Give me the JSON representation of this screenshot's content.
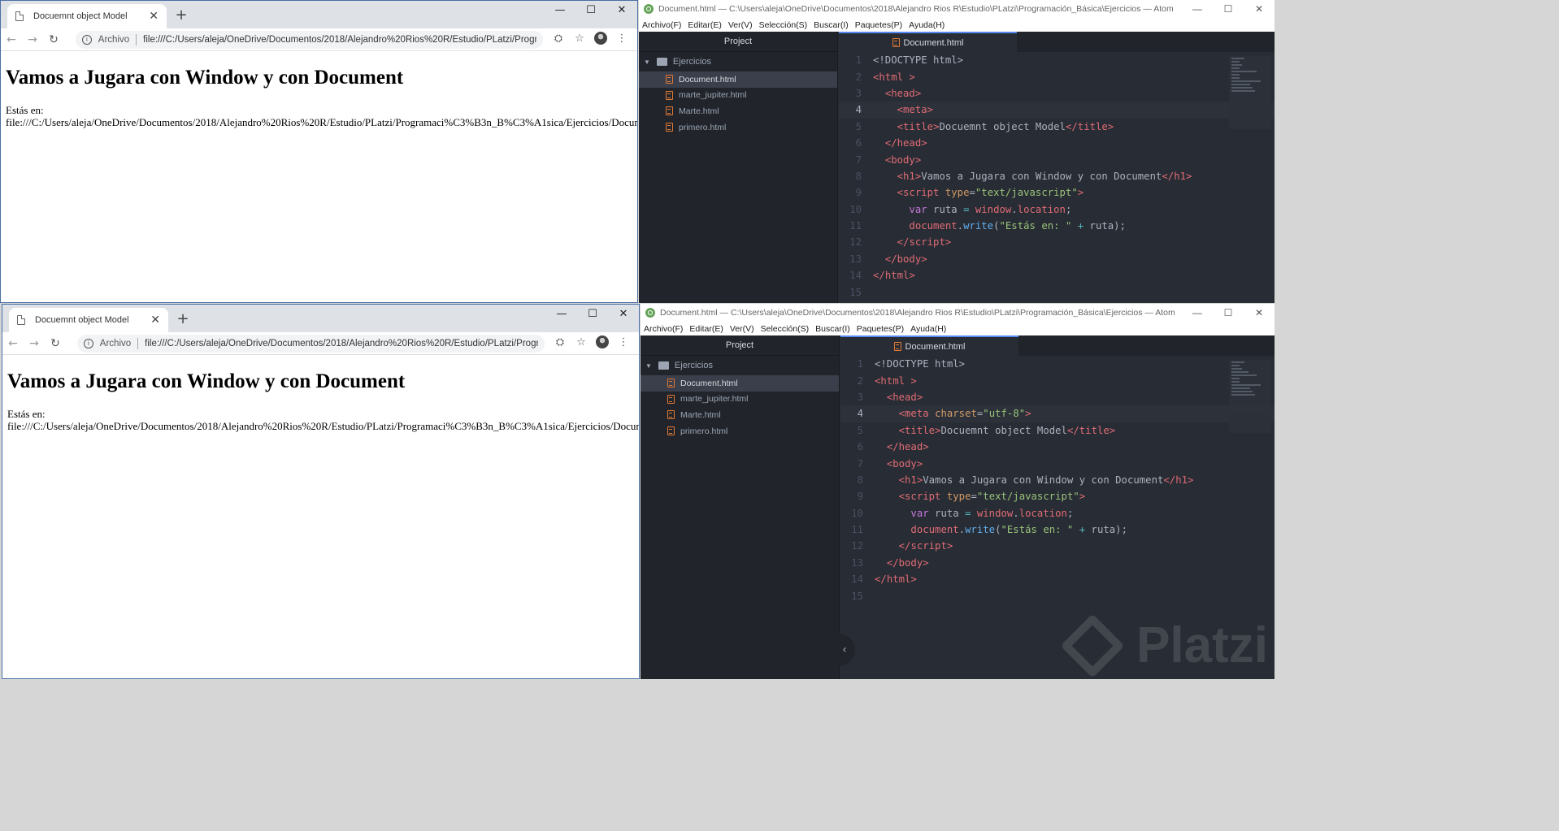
{
  "browser": {
    "tab_title": "Docuemnt object Model",
    "address_prefix": "Archivo",
    "url": "file:///C:/Users/aleja/OneDrive/Documentos/2018/Alejandro%20Rios%20R/Estudio/PLatzi/Progr...",
    "heading": "Vamos a Jugara con Window y con Document",
    "text_line1": "Estás en:",
    "text_line2": "file:///C:/Users/aleja/OneDrive/Documentos/2018/Alejandro%20Rios%20R/Estudio/PLatzi/Programaci%C3%B3n_B%C3%A1sica/Ejercicios/Document.html"
  },
  "atom": {
    "window_title": "Document.html — C:\\Users\\aleja\\OneDrive\\Documentos\\2018\\Alejandro Rios R\\Estudio\\PLatzi\\Programación_Básica\\Ejercicios — Atom",
    "menu": [
      "Archivo(F)",
      "Editar(E)",
      "Ver(V)",
      "Selección(S)",
      "Buscar(I)",
      "Paquetes(P)",
      "Ayuda(H)"
    ],
    "project_label": "Project",
    "folder": "Ejercicios",
    "files": [
      "Document.html",
      "marte_jupiter.html",
      "Marte.html",
      "primero.html"
    ],
    "active_tab": "Document.html",
    "line_numbers": [
      "1",
      "2",
      "3",
      "4",
      "5",
      "6",
      "7",
      "8",
      "9",
      "10",
      "11",
      "12",
      "13",
      "14",
      "15"
    ],
    "code_lines": {
      "l1": "<!DOCTYPE html>",
      "l2a": "<",
      "l2b": "html",
      "l2c": " >",
      "head_open": "head",
      "meta": "meta",
      "meta_attr": "charset",
      "meta_val": "\"utf-8\"",
      "title_tag": "title",
      "title_text": "Docuemnt object Model",
      "body": "body",
      "h1": "h1",
      "h1_text": "Vamos a Jugara con Window y con Document",
      "script": "script",
      "type_attr": "type",
      "type_val": "\"text/javascript\"",
      "var": "var",
      "ruta": " ruta ",
      "eq": "=",
      "window": "window",
      "location": "location",
      "document": "document",
      "write": "write",
      "str": "\"Estás en: \"",
      "plus": "+",
      "ruta_end": " ruta);"
    }
  },
  "watermark": "Platzi"
}
